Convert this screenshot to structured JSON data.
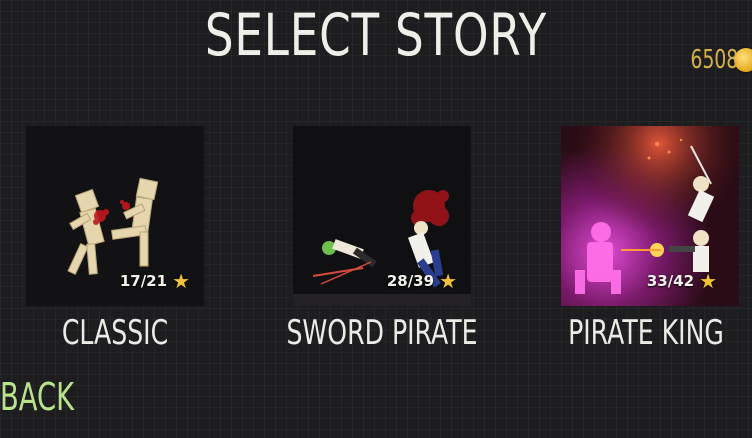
{
  "screen": {
    "title": "SELECT STORY"
  },
  "coins": {
    "value": "6508",
    "icon": "coin-icon"
  },
  "stories": [
    {
      "label": "CLASSIC",
      "progress": "17/21",
      "stars_collected": 17,
      "stars_total": 21,
      "icon": "star-icon"
    },
    {
      "label": "SWORD PIRATE",
      "progress": "28/39",
      "stars_collected": 28,
      "stars_total": 39,
      "icon": "star-icon"
    },
    {
      "label": "PIRATE KING",
      "progress": "33/42",
      "stars_collected": 33,
      "stars_total": 42,
      "icon": "star-icon"
    }
  ],
  "navigation": {
    "back_label": "BACK"
  },
  "colors": {
    "background": "#1d1d20",
    "title_text": "#efeee8",
    "coin_text": "#d7b14a",
    "back_text": "#b8e38a",
    "star": "#f2c336"
  }
}
